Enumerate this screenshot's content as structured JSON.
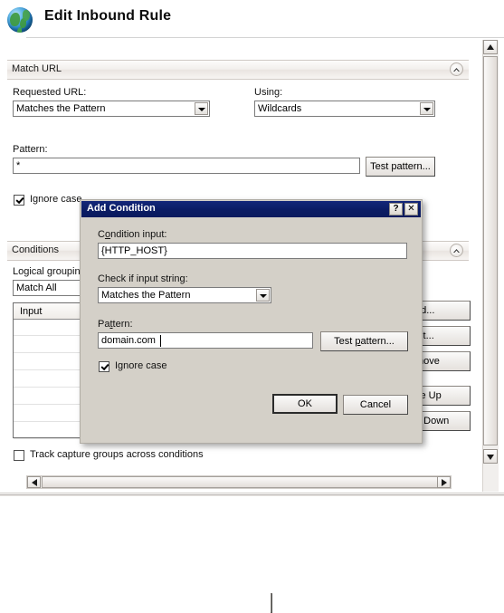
{
  "header": {
    "title": "Edit Inbound Rule",
    "icon": "globe-icon"
  },
  "match_url": {
    "section_title": "Match URL",
    "collapse_icon": "chevron-up-icon",
    "requested_url_label": "Requested URL:",
    "requested_url_value": "Matches the Pattern",
    "using_label": "Using:",
    "using_value": "Wildcards",
    "pattern_label": "Pattern:",
    "pattern_value": "*",
    "test_pattern_label": "Test pattern...",
    "ignore_case_label": "Ignore case",
    "ignore_case_checked": true
  },
  "conditions": {
    "section_title": "Conditions",
    "collapse_icon": "chevron-up-icon",
    "logical_grouping_label": "Logical grouping:",
    "logical_grouping_value": "Match All",
    "table_header": "Input",
    "rows": [],
    "buttons": [
      {
        "label": "Add...",
        "visible_text": "dd..."
      },
      {
        "label": "Edit...",
        "visible_text": "dit..."
      },
      {
        "label": "Remove",
        "visible_text": "move"
      },
      {
        "label": "Move Up",
        "visible_text": "ve Up"
      },
      {
        "label": "Move Down",
        "visible_text": "e Down"
      }
    ],
    "track_capture_label": "Track capture groups across conditions",
    "track_capture_checked": false
  },
  "dialog": {
    "title": "Add Condition",
    "help_button": "?",
    "close_button": "✕",
    "condition_input_label_pre": "C",
    "condition_input_label_mnemonic": "o",
    "condition_input_label_post": "ndition input:",
    "condition_input_value": "{HTTP_HOST}",
    "check_label": "Check if input string:",
    "check_value": "Matches the Pattern",
    "pattern_label_pre": "Pa",
    "pattern_label_mnemonic": "t",
    "pattern_label_post": "tern:",
    "pattern_value": "domain.com",
    "test_pattern_pre": "Test ",
    "test_pattern_mnemonic": "p",
    "test_pattern_post": "attern...",
    "ignore_case_label": "Ignore case",
    "ignore_case_checked": true,
    "ok_label": "OK",
    "cancel_label": "Cancel"
  },
  "scrollbars": {
    "vertical_up_icon": "triangle-up-icon",
    "vertical_down_icon": "triangle-down-icon",
    "horizontal_left_icon": "triangle-left-icon",
    "horizontal_right_icon": "triangle-right-icon"
  },
  "colors": {
    "dialog_titlebar": "#0b1c64",
    "dialog_face": "#d4d0c8",
    "page_bg": "#ffffff"
  }
}
